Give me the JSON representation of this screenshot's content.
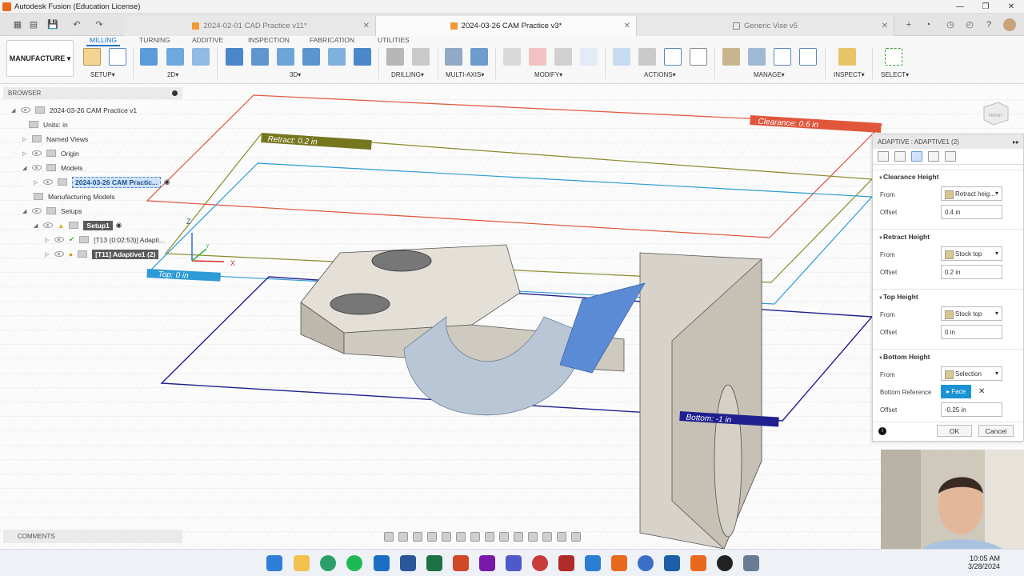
{
  "window": {
    "title": "Autodesk Fusion (Education License)"
  },
  "tabs": [
    {
      "label": "2024-02-01 CAD Practice v11*"
    },
    {
      "label": "2024-03-26 CAM Practice v3*"
    },
    {
      "label": "Generic Vise v5"
    }
  ],
  "workspace": {
    "label": "MANUFACTURE"
  },
  "ribbon": {
    "tabs": [
      "MILLING",
      "TURNING",
      "ADDITIVE",
      "INSPECTION",
      "FABRICATION",
      "UTILITIES"
    ],
    "groups": [
      "SETUP",
      "2D",
      "3D",
      "DRILLING",
      "MULTI-AXIS",
      "MODIFY",
      "ACTIONS",
      "MANAGE",
      "INSPECT",
      "SELECT"
    ]
  },
  "browser": {
    "header": "BROWSER",
    "items": [
      {
        "label": "2024-03-26 CAM Practice v1"
      },
      {
        "label": "Units: in"
      },
      {
        "label": "Named Views"
      },
      {
        "label": "Origin"
      },
      {
        "label": "Models"
      },
      {
        "label": "2024-03-26 CAM Practic..."
      },
      {
        "label": "Manufacturing Models"
      },
      {
        "label": "Setups"
      },
      {
        "label": "Setup1"
      },
      {
        "label": "[T13 (0:02:53)] Adapti..."
      },
      {
        "label": "[T11] Adaptive1 (2)"
      }
    ],
    "comments": "COMMENTS"
  },
  "viewport": {
    "labels": {
      "clearance": "Clearance: 0.6 in",
      "retract": "Retract: 0.2 in",
      "top": "Top: 0 in",
      "bottom": "Bottom: -1 in"
    },
    "axes": {
      "x": "X",
      "y": "Y",
      "z": "Z"
    },
    "viewcube": "FRONT"
  },
  "panel": {
    "title": "ADAPTIVE : ADAPTIVE1 (2)",
    "sections": {
      "clearance": "Clearance Height",
      "retract": "Retract Height",
      "top": "Top Height",
      "bottom": "Bottom Height"
    },
    "from_label": "From",
    "offset_label": "Offset",
    "clearance": {
      "from": "Retract heig...",
      "offset": "0.4 in"
    },
    "retract": {
      "from": "Stock top",
      "offset": "0.2 in"
    },
    "top": {
      "from": "Stock top",
      "offset": "0 in"
    },
    "bottom": {
      "from": "Selection",
      "reference_label": "Bottom Reference",
      "reference": "Face",
      "offset": "-0.25 in"
    },
    "ok": "OK",
    "cancel": "Cancel"
  },
  "clock": {
    "time": "10:05 AM",
    "date": "3/28/2024"
  }
}
